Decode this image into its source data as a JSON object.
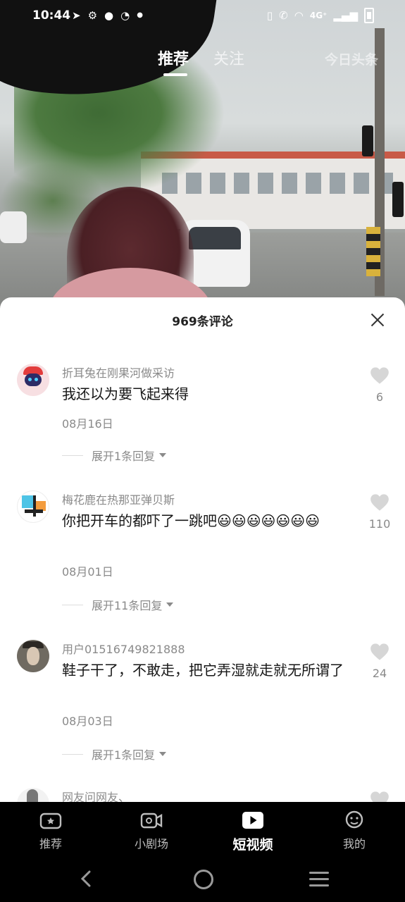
{
  "status_bar": {
    "time": "10:44",
    "network": "4G⁺",
    "icons_left": [
      "send-icon",
      "gear-icon",
      "location-icon",
      "speed-icon",
      "dot-icon"
    ],
    "icons_right": [
      "vibrate-icon",
      "wifi-call-icon",
      "wifi-icon",
      "signal-icon",
      "battery-icon"
    ]
  },
  "top_tabs": {
    "recommend": "推荐",
    "follow": "关注",
    "brand": "今日头条"
  },
  "comments_sheet": {
    "title": "969条评论",
    "comments": [
      {
        "user": "折耳兔在刚果河做采访",
        "text": "我还以为要飞起来得",
        "date": "08月16日",
        "expand": "展开1条回复",
        "likes": "6"
      },
      {
        "user": "梅花鹿在热那亚弹贝斯",
        "text": "你把开车的都吓了一跳吧😃😃😃😃😃😃😃",
        "date": "08月01日",
        "expand": "展开11条回复",
        "likes": "110"
      },
      {
        "user": "用户01516749821888",
        "text": "鞋子干了，不敢走，把它弄湿就走就无所谓了",
        "date": "08月03日",
        "expand": "展开1条回复",
        "likes": "24"
      },
      {
        "user": "网友问网友、",
        "text": "",
        "date": "",
        "expand": "",
        "likes": ""
      }
    ]
  },
  "bottom_nav": {
    "items": [
      {
        "label": "推荐",
        "icon": "home-recommend-icon"
      },
      {
        "label": "小剧场",
        "icon": "video-camera-icon"
      },
      {
        "label": "短视频",
        "icon": "play-icon",
        "active": true
      },
      {
        "label": "我的",
        "icon": "profile-icon"
      }
    ]
  },
  "colors": {
    "sheet_bg": "#ffffff",
    "text_primary": "#161616",
    "text_secondary": "#8a8a8a",
    "heart": "#d6d6d6",
    "nav_bg": "#000000"
  }
}
